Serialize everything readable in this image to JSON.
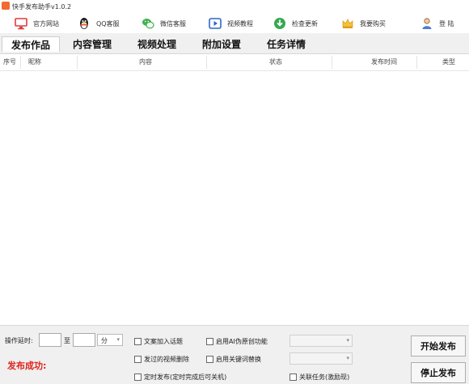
{
  "window": {
    "title": "快手发布助手v1.0.2"
  },
  "toolbar": {
    "items": [
      {
        "label": "官方网站",
        "icon": "monitor-icon"
      },
      {
        "label": "QQ客服",
        "icon": "qq-penguin-icon"
      },
      {
        "label": "微信客服",
        "icon": "wechat-icon"
      },
      {
        "label": "视频教程",
        "icon": "video-play-icon"
      },
      {
        "label": "检查更新",
        "icon": "download-icon"
      },
      {
        "label": "我要购买",
        "icon": "crown-icon"
      },
      {
        "label": "登 陆",
        "icon": "user-icon"
      }
    ]
  },
  "tabs": [
    {
      "label": "发布作品",
      "active": true
    },
    {
      "label": "内容管理"
    },
    {
      "label": "视频处理"
    },
    {
      "label": "附加设置"
    },
    {
      "label": "任务详情"
    }
  ],
  "table": {
    "columns": [
      "序号",
      "昵称",
      "内容",
      "状态",
      "发布时间",
      "类型"
    ]
  },
  "footer": {
    "interval_label": "操作延时:",
    "range_to": "至",
    "unit": "分",
    "checkboxes": {
      "topic": "文案加入话题",
      "delete_after": "发过的视频删除",
      "timed_publish": "定时发布(定时完成后可关机)",
      "ai_original": "启用AI伪原创功能",
      "keyword_replace": "启用关键词替换",
      "associate_task": "关联任务(激励现)"
    },
    "status_text": "发布成功:",
    "start_button": "开始发布",
    "stop_button": "停止发布"
  },
  "colors": {
    "status_red": "#e0211b",
    "app_orange": "#f26b2f"
  }
}
